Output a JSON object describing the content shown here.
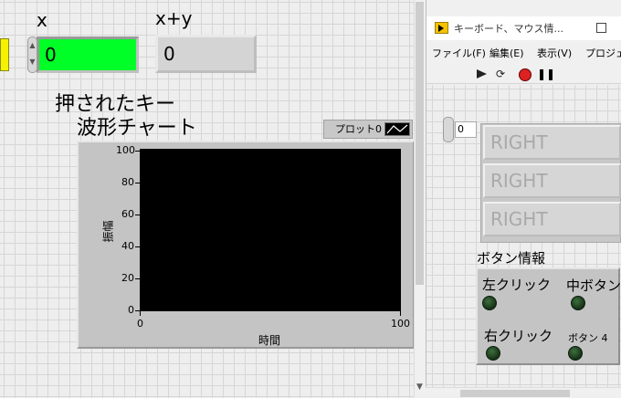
{
  "front_panel": {
    "x_label": "x",
    "x_value": "0",
    "xy_label": "x+y",
    "xy_value": "0",
    "chart_title": "波形チャート",
    "legend_label": "プロット0",
    "chart_data": {
      "type": "line",
      "title": "波形チャート",
      "xlabel": "時間",
      "ylabel": "振幅",
      "xlim": [
        0,
        100
      ],
      "ylim": [
        0,
        100
      ],
      "x_ticks": [
        "0",
        "100"
      ],
      "y_ticks": [
        "100",
        "80",
        "60",
        "40",
        "20",
        "0"
      ],
      "series": [
        {
          "name": "プロット0",
          "values": []
        }
      ],
      "grid": false
    }
  },
  "window": {
    "title": "キーボード、マウス情...",
    "menu": [
      "ファイル(F)",
      "編集(E)",
      "表示(V)",
      "プロジェク"
    ],
    "toolbar": {
      "run_continuous_icon": "⟳",
      "pause_icon": "❚❚"
    },
    "keys_title": "押されたキー",
    "array_index": "0",
    "keys": [
      "RIGHT",
      "RIGHT",
      "RIGHT"
    ],
    "button_info_label": "ボタン情報",
    "buttons": {
      "left": "左クリック",
      "middle": "中ボタン",
      "right": "右クリック",
      "button4": "ボタン 4"
    }
  },
  "colors": {
    "numeric_control": "#00ff26",
    "plot_background": "#000000",
    "led_off": "#1e3f1e",
    "indicator_yellow": "#f5f200"
  }
}
